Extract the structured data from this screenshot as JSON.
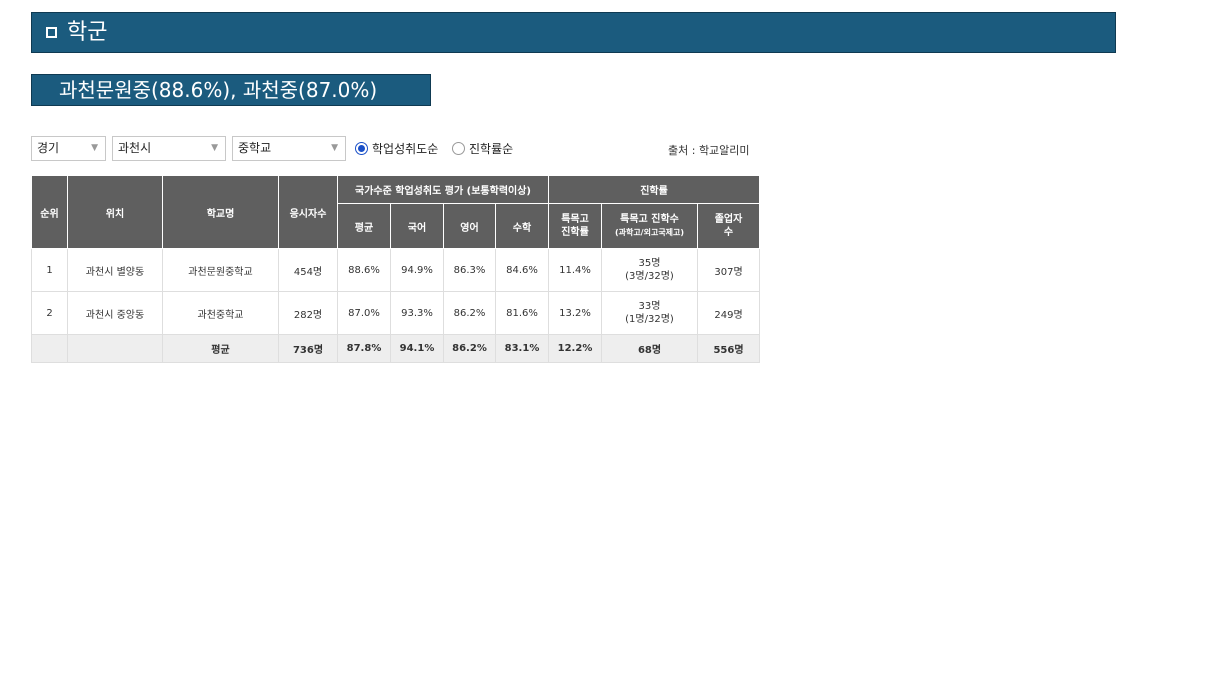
{
  "section": {
    "title": "학군"
  },
  "highlight": {
    "text": "과천문원중(88.6%), 과천중(87.0%)"
  },
  "filters": {
    "region": "경기",
    "city": "과천시",
    "school_level": "중학교",
    "sort_options": [
      {
        "label": "학업성취도순",
        "selected": true
      },
      {
        "label": "진학률순",
        "selected": false
      }
    ],
    "source": "출처 : 학교알리미"
  },
  "table": {
    "headers": {
      "rank": "순위",
      "location": "위치",
      "school": "학교명",
      "examinees": "응시자수",
      "achievement_group": "국가수준 학업성취도 평가 (보통학력이상)",
      "avg": "평균",
      "korean": "국어",
      "english": "영어",
      "math": "수학",
      "advancement_group": "진학률",
      "special_rate_1": "특목고",
      "special_rate_2": "진학률",
      "special_count_1": "특목고 진학수",
      "special_count_2": "(과학고/외고국제고)",
      "graduates_1": "졸업자",
      "graduates_2": "수"
    },
    "rows": [
      {
        "rank": "1",
        "location": "과천시 별양동",
        "school": "과천문원중학교",
        "examinees": "454명",
        "avg": "88.6%",
        "korean": "94.9%",
        "english": "86.3%",
        "math": "84.6%",
        "special_rate": "11.4%",
        "special_count": "35명",
        "special_detail": "(3명/32명)",
        "graduates": "307명"
      },
      {
        "rank": "2",
        "location": "과천시 중앙동",
        "school": "과천중학교",
        "examinees": "282명",
        "avg": "87.0%",
        "korean": "93.3%",
        "english": "86.2%",
        "math": "81.6%",
        "special_rate": "13.2%",
        "special_count": "33명",
        "special_detail": "(1명/32명)",
        "graduates": "249명"
      }
    ],
    "average": {
      "label": "평균",
      "examinees": "736명",
      "avg": "87.8%",
      "korean": "94.1%",
      "english": "86.2%",
      "math": "83.1%",
      "special_rate": "12.2%",
      "special_count": "68명",
      "graduates": "556명"
    }
  },
  "colors": {
    "header_bg": "#1b5b7e",
    "table_header_bg": "#5f5f5f",
    "radio_accent": "#1a50c8"
  }
}
